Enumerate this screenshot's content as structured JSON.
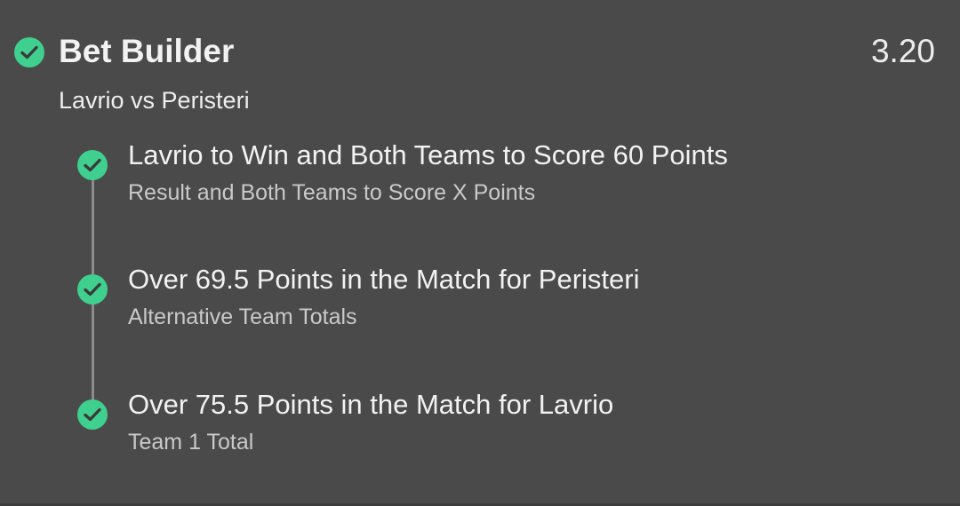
{
  "bet": {
    "title": "Bet Builder",
    "odds": "3.20",
    "match": "Lavrio vs Peristeri",
    "status_icon": "check-circle-icon"
  },
  "legs": [
    {
      "title": "Lavrio to Win and Both Teams to Score 60 Points",
      "market": "Result and Both Teams to Score X Points",
      "status_icon": "check-circle-icon"
    },
    {
      "title": "Over 69.5 Points in the Match for Peristeri",
      "market": "Alternative Team Totals",
      "status_icon": "check-circle-icon"
    },
    {
      "title": "Over 75.5 Points in the Match for Lavrio",
      "market": "Team 1 Total",
      "status_icon": "check-circle-icon"
    }
  ],
  "colors": {
    "background": "#4a4a4a",
    "accent_green": "#3fd08f",
    "primary_text": "#f2f2f2",
    "secondary_text": "#c9c9c9",
    "timeline": "#8c8c8c"
  }
}
